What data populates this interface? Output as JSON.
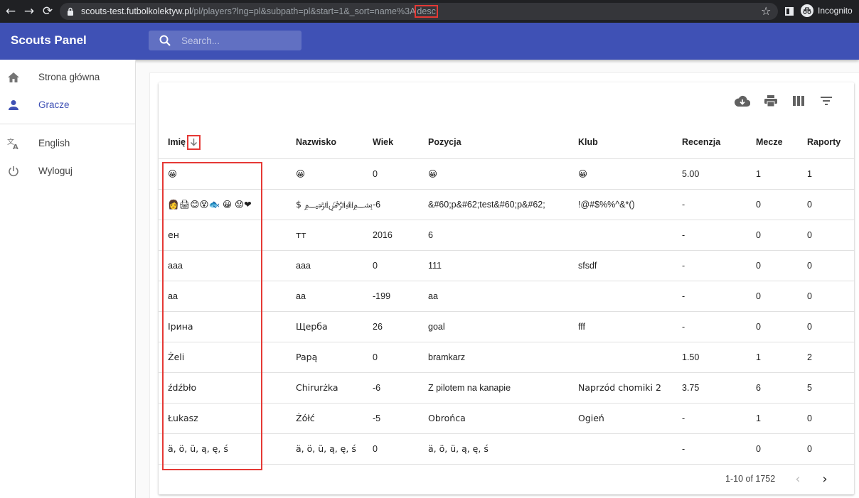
{
  "browser": {
    "url_host": "scouts-test.futbolkolektyw.pl",
    "url_path": "/pl/players?lng=pl&subpath=pl&start=1&_sort=name%3A",
    "url_highlight": "desc",
    "profile_label": "Incognito"
  },
  "app": {
    "title": "Scouts Panel",
    "search_placeholder": "Search..."
  },
  "sidebar": {
    "items": [
      {
        "label": "Strona główna",
        "icon": "home-icon"
      },
      {
        "label": "Gracze",
        "icon": "person-icon"
      },
      {
        "label": "English",
        "icon": "translate-icon"
      },
      {
        "label": "Wyloguj",
        "icon": "power-icon"
      }
    ]
  },
  "table": {
    "columns": [
      "Imię",
      "Nazwisko",
      "Wiek",
      "Pozycja",
      "Klub",
      "Recenzja",
      "Mecze",
      "Raporty"
    ],
    "sort": {
      "column": "Imię",
      "direction": "desc"
    },
    "rows": [
      [
        "😀",
        "😀",
        "0",
        "😀",
        "😀",
        "5.00",
        "1",
        "1"
      ],
      [
        "👩🖨😊😵🐟 😀 😟❤",
        "$ ﷽ ",
        "-6",
        "&#60;p&#62;test&#60;p&#62;",
        "!@#$%%^&*()",
        "-",
        "0",
        "0"
      ],
      [
        "ен",
        "тт",
        "2016",
        "6",
        "",
        "-",
        "0",
        "0"
      ],
      [
        "aaa",
        "aaa",
        "0",
        "111",
        "sfsdf",
        "-",
        "0",
        "0"
      ],
      [
        "aa",
        "aa",
        "-199",
        "aa",
        "",
        "-",
        "0",
        "0"
      ],
      [
        "Ірина",
        "Щерба",
        "26",
        "goal",
        "fff",
        "-",
        "0",
        "0"
      ],
      [
        "Żeli",
        "Papą",
        "0",
        "bramkarz",
        "",
        "1.50",
        "1",
        "2"
      ],
      [
        "źdźbło",
        "Chirurżka",
        "-6",
        "Z pilotem na kanapie",
        "Naprzód chomiki 2",
        "3.75",
        "6",
        "5"
      ],
      [
        "Łukasz",
        "Żółć",
        "-5",
        "Obrońca",
        "Ogień",
        "-",
        "1",
        "0"
      ],
      [
        "ä, ö, ü, ą, ę, ś",
        "ä, ö, ü, ą, ę, ś",
        "0",
        "ä, ö, ü, ą, ę, ś",
        "",
        "-",
        "0",
        "0"
      ]
    ],
    "pagination": "1-10 of 1752"
  },
  "colors": {
    "appbar": "#3f51b5",
    "active": "#3f51b5",
    "annotation": "#e53935"
  }
}
